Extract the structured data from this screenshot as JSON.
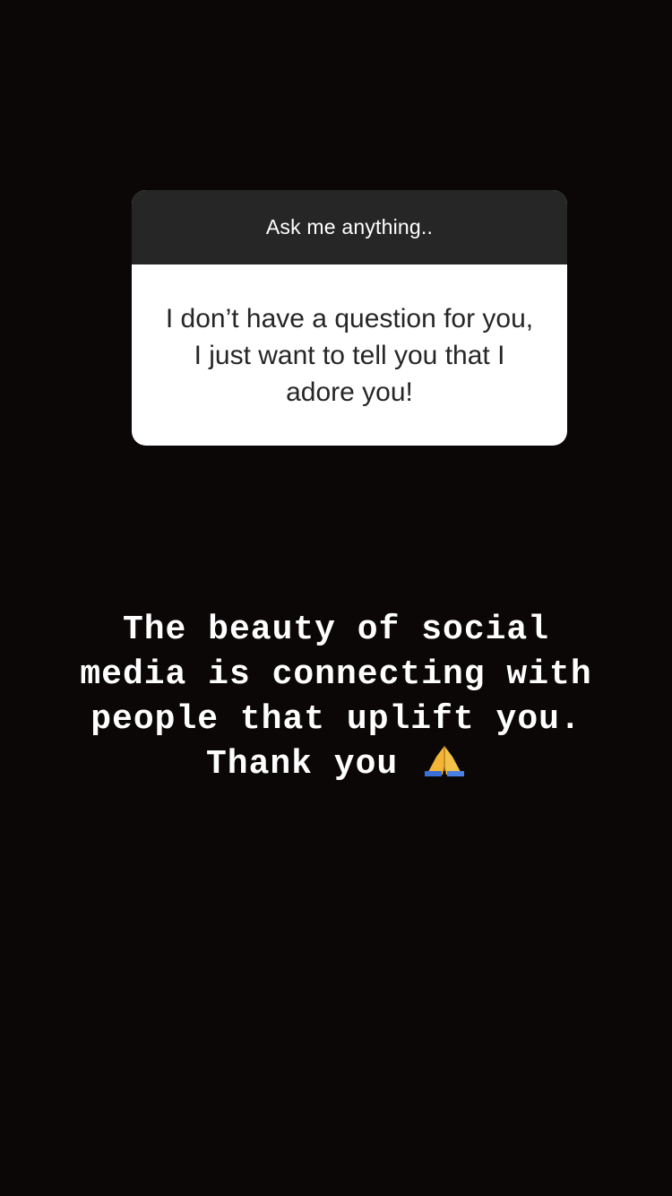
{
  "question_box": {
    "header": "Ask me anything..",
    "answer": "I don’t have a question for you, I just want to tell you that I adore you!"
  },
  "caption": {
    "lines": [
      "The beauty of social",
      "media is connecting with",
      "people that uplift you.",
      "Thank you"
    ],
    "emoji": "folded-hands-icon"
  },
  "colors": {
    "background": "#0c0707",
    "header_bg": "#262626",
    "body_bg": "#ffffff",
    "caption_text": "#ffffff"
  }
}
